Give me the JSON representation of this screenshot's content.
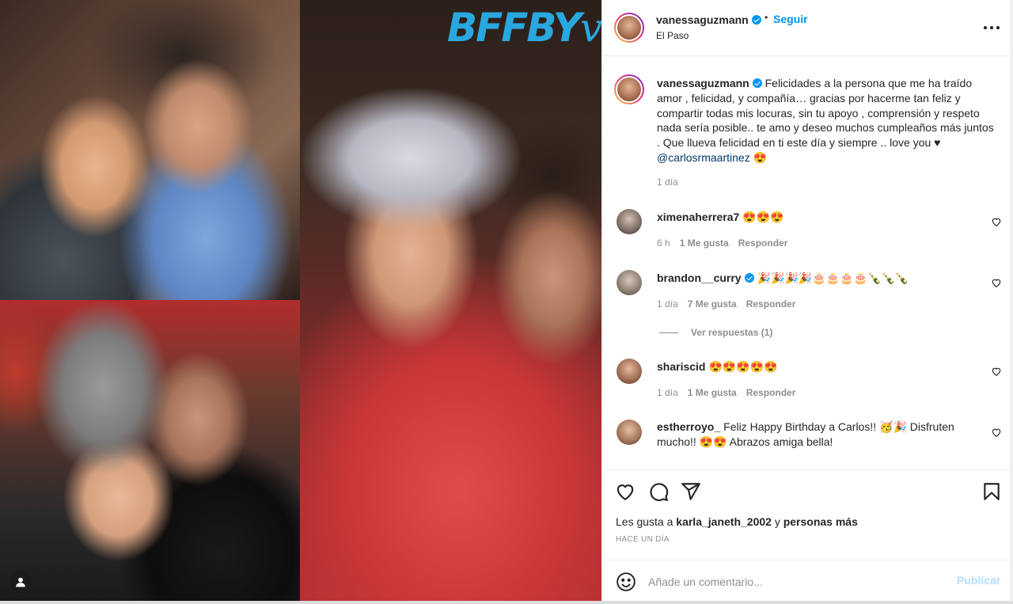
{
  "media": {
    "brand_text": "BFFBY",
    "brand_script": "vg",
    "brand_color": "#29a8e0"
  },
  "header": {
    "username": "vanessaguzmann",
    "separator": "•",
    "follow_label": "Seguir",
    "location": "El Paso"
  },
  "caption": {
    "username": "vanessaguzmann",
    "text": "Felicidades a la persona que me ha traído amor , felicidad, y compañía… gracias por hacerme tan feliz y compartir todas mis locuras, sin tu apoyo , comprensión y respeto nada sería posible.. te amo y deseo muchos cumpleaños más juntos . Que llueva felicidad en ti este día y siempre .. love you ♥",
    "mention": "@carlosrmaartinez",
    "emoji": "😍",
    "time": "1 día"
  },
  "comments": [
    {
      "username": "ximenaherrera7",
      "text": "😍😍😍",
      "time": "6 h",
      "likes": "1 Me gusta",
      "reply": "Responder",
      "verified": false
    },
    {
      "username": "brandon__curry",
      "text": "🎉🎉🎉🎉🎂🎂🎂🎂🍾🍾🍾",
      "time": "1 día",
      "likes": "7 Me gusta",
      "reply": "Responder",
      "verified": true
    },
    {
      "username": "shariscid",
      "text": "😍😍😍😍😍",
      "time": "1 día",
      "likes": "1 Me gusta",
      "reply": "Responder",
      "verified": false
    },
    {
      "username": "estherroyo_",
      "text": "Feliz Happy Birthday a Carlos!! 🥳🎉 Disfruten mucho!! 😍😍 Abrazos amiga bella!",
      "verified": false
    }
  ],
  "view_replies": "Ver respuestas (1)",
  "likes_line": {
    "prefix": "Les gusta a",
    "user": "karla_janeth_2002",
    "middle": "y",
    "others": "personas más"
  },
  "time_ago": "HACE UN DÍA",
  "add_comment": {
    "placeholder": "Añade un comentario...",
    "publish": "Publicar"
  },
  "colors": {
    "accent": "#0095f6",
    "publish_disabled": "#b2dffc",
    "muted": "#8e8e8e"
  }
}
